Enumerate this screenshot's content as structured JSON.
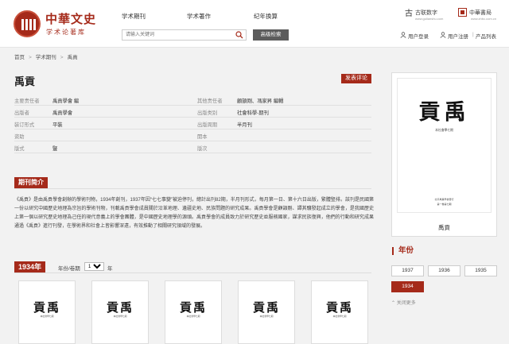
{
  "header": {
    "logo_title": "中華文史",
    "logo_subtitle": "学术论著库",
    "nav": [
      "学术期刊",
      "学术著作",
      "纪年换算"
    ],
    "search_placeholder": "请输入关键词",
    "advanced_search": "高级检索",
    "brand_left": "古联数字",
    "brand_left_sub": "www.gulianshu.com",
    "brand_right": "中華書局",
    "brand_right_sub": "www.zhbc.com.cn",
    "user_login": "用户登录",
    "user_register": "用户注册",
    "product_list": "产品列表"
  },
  "breadcrumb": [
    "首页",
    "学术期刊",
    "禹貢"
  ],
  "title": "禹貢",
  "review_button": "发表评论",
  "meta": [
    {
      "k1": "主要责任者",
      "v1": "禹貢學會 編",
      "k2": "其他责任者",
      "v2": "顧頡剛、馮家昇 編輯"
    },
    {
      "k1": "出版者",
      "v1": "禹貢學會",
      "k2": "出版类别",
      "v2": "社會科學-期刊"
    },
    {
      "k1": "装订形式",
      "v1": "平裝",
      "k2": "出版周期",
      "v2": "半月刊"
    },
    {
      "k1": "资助",
      "v1": "",
      "k2": "開本",
      "v2": ""
    },
    {
      "k1": "版式",
      "v1": "豎",
      "k2": "版次",
      "v2": ""
    }
  ],
  "intro_heading": "期刊简介",
  "intro_text": "《禹貢》是由禹貢學會創辦的學術刊物，1934年創刊，1937年因“七七事變”被迫停刊，總計出刊82期，半月刊形式，每月第一日、第十六日出版，繁體豎排。該刊是民國第一份以研究中國歷史地理為宗旨的學術刊物，刊載禹貢學會成員關於沿革地理、邊疆史地、民族問題的研究成果。禹貢學會是顧頡剛、譚其驤發起成立的學會，是我國歷史上第一個以研究歷史地理為己任的現代意義上的學會團體，是中國歷史地理學的源頭。禹貢學會的成員致力於研究歷史並服務國家，謀求民族復興，他們的行動和研究成果通過《禹貢》進行刊發，在學術界和社會上皆影響深遠，有效推動了相關研究領域的發展。",
  "year_block": {
    "year_label": "1934年",
    "issue_label": "年份/卷期",
    "selected_year": "1934",
    "suffix": "年"
  },
  "cover": {
    "title": "貢禹",
    "subtitle": "本社會學七期",
    "bottom_line1": "北平禹貢學會發行",
    "bottom_line2": "第一卷第七期",
    "name": "禹貢"
  },
  "sidebar": {
    "year_heading": "年份",
    "years": [
      "1937",
      "1936",
      "1935",
      "1934"
    ],
    "active_year": "1934",
    "close_more": "关闭更多"
  },
  "colors": {
    "accent": "#a52a1a",
    "dark_button": "#5c5c5c"
  }
}
